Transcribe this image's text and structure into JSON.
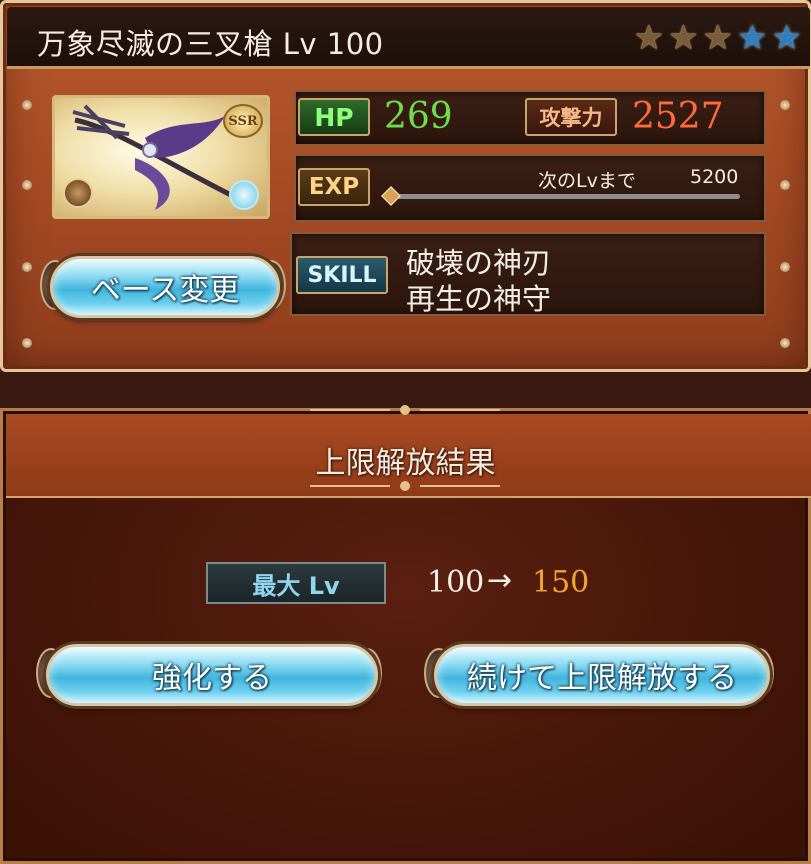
{
  "card": {
    "weapon_name": "万象尽滅の三叉槍 Lv 100",
    "rarity_badge": "SSR",
    "stars": [
      {
        "kind": "bronze",
        "icon": "star-icon"
      },
      {
        "kind": "bronze",
        "icon": "star-icon"
      },
      {
        "kind": "bronze",
        "icon": "star-icon"
      },
      {
        "kind": "blue",
        "icon": "star-icon"
      },
      {
        "kind": "blue",
        "icon": "star-icon"
      }
    ],
    "base_change_button": "ベース変更",
    "hp_tag": "HP",
    "hp_value": "269",
    "atk_tag": "攻撃力",
    "atk_value": "2527",
    "exp_tag": "EXP",
    "exp_next_label": "次のLvまで",
    "exp_next_value": "5200",
    "exp_progress": 0.0,
    "skill_tag": "SKILL",
    "skills": [
      "破壊の神刃",
      "再生の神守"
    ]
  },
  "result": {
    "title": "上限解放結果",
    "max_lv_tag": "最大 Lv",
    "lv_old": "100",
    "lv_arrow": "→",
    "lv_new": "150",
    "enhance_button": "強化する",
    "continue_button": "続けて上限解放する"
  },
  "colors": {
    "hp": "#6fdc4a",
    "atk": "#ff6a3a",
    "lv_new": "#f2a42c",
    "button": "#41b5de"
  }
}
